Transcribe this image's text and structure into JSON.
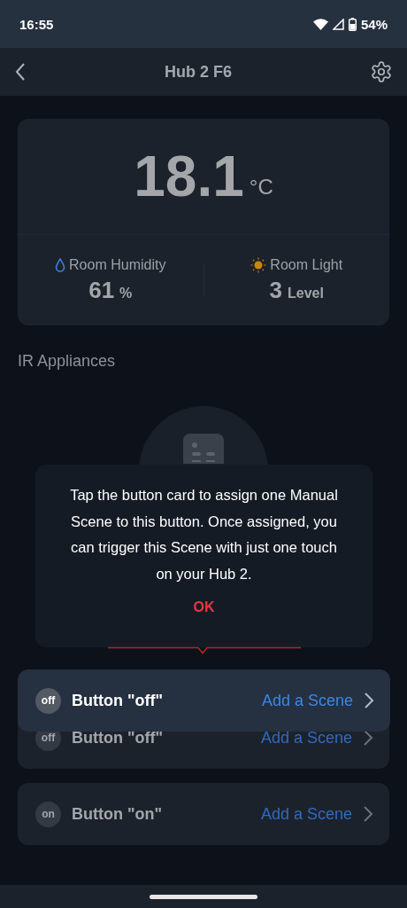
{
  "status_bar": {
    "time": "16:55",
    "battery": "54%"
  },
  "header": {
    "title": "Hub 2 F6"
  },
  "climate": {
    "temperature": "18.1",
    "temperature_unit": "°C",
    "stats": [
      {
        "kind": "humidity",
        "label": "Room Humidity",
        "value": "61",
        "unit": "%"
      },
      {
        "kind": "light",
        "label": "Room Light",
        "value": "3",
        "unit": "Level"
      }
    ]
  },
  "section_title": "IR Appliances",
  "buttons": [
    {
      "symbol": "off",
      "label": "Button \"off\"",
      "action": "Add a Scene"
    },
    {
      "symbol": "on",
      "label": "Button \"on\"",
      "action": "Add a Scene"
    }
  ],
  "coach_mark": {
    "message": "Tap the button card to assign one Manual Scene to this button. Once assigned, you can trigger this Scene with just one touch on your Hub 2.",
    "confirm": "OK",
    "highlight": {
      "symbol": "off",
      "label": "Button \"off\"",
      "action": "Add a Scene"
    }
  }
}
